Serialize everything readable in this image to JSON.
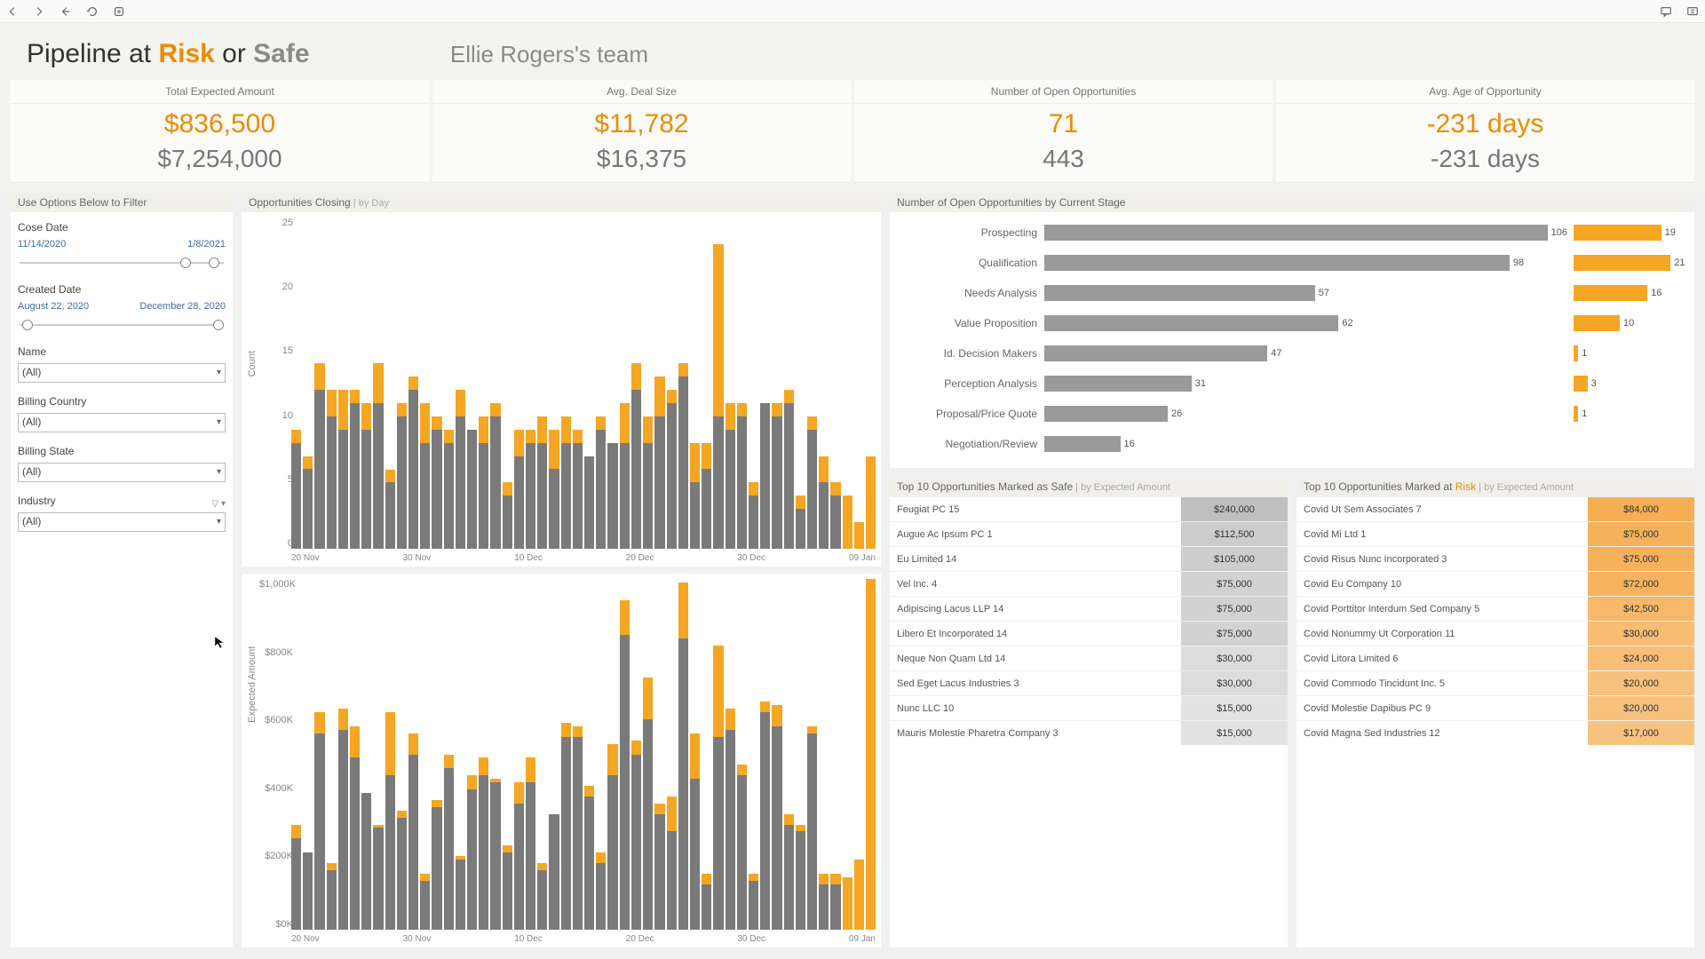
{
  "toolbar_icons": [
    "back",
    "forward",
    "undo-stop",
    "refresh-data",
    "pause-data",
    "comment",
    "present"
  ],
  "title": {
    "prefix": "Pipeline at ",
    "risk": "Risk",
    "middle": " or ",
    "safe": "Safe",
    "team": "Ellie Rogers's team"
  },
  "kpis": [
    {
      "label": "Total Expected Amount",
      "v1": "$836,500",
      "v2": "$7,254,000"
    },
    {
      "label": "Avg. Deal Size",
      "v1": "$11,782",
      "v2": "$16,375"
    },
    {
      "label": "Number of Open Opportunities",
      "v1": "71",
      "v2": "443"
    },
    {
      "label": "Avg. Age of Opportunity",
      "v1": "-231 days",
      "v2": "-231 days"
    }
  ],
  "filters": {
    "title": "Use Options Below to Filter",
    "close_date": {
      "label": "Cose Date",
      "from": "11/14/2020",
      "to": "1/8/2021",
      "knob1": 0.78,
      "knob2": 0.92
    },
    "created_date": {
      "label": "Created Date",
      "from": "August 22, 2020",
      "to": "December 28, 2020",
      "knob1": 0.02,
      "knob2": 0.94
    },
    "name": {
      "label": "Name",
      "value": "(All)"
    },
    "country": {
      "label": "Billing Country",
      "value": "(All)"
    },
    "state": {
      "label": "Billing State",
      "value": "(All)"
    },
    "industry": {
      "label": "Industry",
      "value": "(All)"
    }
  },
  "charts_panel_title": "Opportunities Closing",
  "charts_panel_sub": " | by Day",
  "stage_panel_title": "Number of Open Opportunities by Current Stage",
  "safe_table_title": "Top 10 Opportunities Marked as Safe",
  "risk_table_title": "Top 10 Opportunities Marked at ",
  "risk_table_risk_word": "Risk",
  "table_subtitle": " | by Expected Amount",
  "chart_data": [
    {
      "type": "bar",
      "title": "Opportunities Closing | by Day (Count)",
      "ylabel": "Count",
      "ylim": [
        0,
        25
      ],
      "yticks": [
        25,
        20,
        15,
        10,
        5,
        0
      ],
      "x_ticks": [
        "20 Nov",
        "30 Nov",
        "10 Dec",
        "20 Dec",
        "30 Dec",
        "09 Jan"
      ],
      "series": [
        {
          "name": "Safe",
          "color": "#7a7a7a"
        },
        {
          "name": "Risk",
          "color": "#f5a623"
        }
      ],
      "stacked": true,
      "data": [
        {
          "safe": 8,
          "risk": 1
        },
        {
          "safe": 6,
          "risk": 1
        },
        {
          "safe": 12,
          "risk": 2
        },
        {
          "safe": 10,
          "risk": 2
        },
        {
          "safe": 9,
          "risk": 3
        },
        {
          "safe": 11,
          "risk": 1
        },
        {
          "safe": 9,
          "risk": 2
        },
        {
          "safe": 11,
          "risk": 3
        },
        {
          "safe": 5,
          "risk": 1
        },
        {
          "safe": 10,
          "risk": 1
        },
        {
          "safe": 12,
          "risk": 1
        },
        {
          "safe": 8,
          "risk": 3
        },
        {
          "safe": 9,
          "risk": 1
        },
        {
          "safe": 8,
          "risk": 1
        },
        {
          "safe": 10,
          "risk": 2
        },
        {
          "safe": 9,
          "risk": 0
        },
        {
          "safe": 8,
          "risk": 2
        },
        {
          "safe": 10,
          "risk": 1
        },
        {
          "safe": 4,
          "risk": 1
        },
        {
          "safe": 7,
          "risk": 2
        },
        {
          "safe": 8,
          "risk": 1
        },
        {
          "safe": 8,
          "risk": 2
        },
        {
          "safe": 6,
          "risk": 3
        },
        {
          "safe": 8,
          "risk": 2
        },
        {
          "safe": 8,
          "risk": 1
        },
        {
          "safe": 7,
          "risk": 0
        },
        {
          "safe": 9,
          "risk": 1
        },
        {
          "safe": 8,
          "risk": 0
        },
        {
          "safe": 8,
          "risk": 3
        },
        {
          "safe": 12,
          "risk": 2
        },
        {
          "safe": 8,
          "risk": 2
        },
        {
          "safe": 10,
          "risk": 3
        },
        {
          "safe": 11,
          "risk": 1
        },
        {
          "safe": 13,
          "risk": 1
        },
        {
          "safe": 5,
          "risk": 3
        },
        {
          "safe": 6,
          "risk": 2
        },
        {
          "safe": 10,
          "risk": 13
        },
        {
          "safe": 9,
          "risk": 2
        },
        {
          "safe": 10,
          "risk": 1
        },
        {
          "safe": 4,
          "risk": 1
        },
        {
          "safe": 11,
          "risk": 0
        },
        {
          "safe": 10,
          "risk": 1
        },
        {
          "safe": 11,
          "risk": 1
        },
        {
          "safe": 3,
          "risk": 1
        },
        {
          "safe": 9,
          "risk": 1
        },
        {
          "safe": 5,
          "risk": 2
        },
        {
          "safe": 4,
          "risk": 1
        },
        {
          "safe": 0,
          "risk": 4
        },
        {
          "safe": 0,
          "risk": 2
        },
        {
          "safe": 0,
          "risk": 7
        }
      ]
    },
    {
      "type": "bar",
      "title": "Opportunities Closing | by Day (Expected Amount)",
      "ylabel": "Expected Amount",
      "ylim": [
        0,
        1000
      ],
      "yticks": [
        "$1,000K",
        "$800K",
        "$600K",
        "$400K",
        "$200K",
        "$0K"
      ],
      "x_ticks": [
        "20 Nov",
        "30 Nov",
        "10 Dec",
        "20 Dec",
        "30 Dec",
        "09 Jan"
      ],
      "series": [
        {
          "name": "Safe",
          "color": "#7a7a7a"
        },
        {
          "name": "Risk",
          "color": "#f5a623"
        }
      ],
      "stacked": true,
      "data": [
        {
          "safe": 260,
          "risk": 40
        },
        {
          "safe": 220,
          "risk": 0
        },
        {
          "safe": 560,
          "risk": 60
        },
        {
          "safe": 170,
          "risk": 20
        },
        {
          "safe": 570,
          "risk": 60
        },
        {
          "safe": 490,
          "risk": 90
        },
        {
          "safe": 390,
          "risk": 0
        },
        {
          "safe": 290,
          "risk": 10
        },
        {
          "safe": 440,
          "risk": 180
        },
        {
          "safe": 320,
          "risk": 20
        },
        {
          "safe": 500,
          "risk": 60
        },
        {
          "safe": 140,
          "risk": 20
        },
        {
          "safe": 350,
          "risk": 20
        },
        {
          "safe": 460,
          "risk": 40
        },
        {
          "safe": 200,
          "risk": 10
        },
        {
          "safe": 400,
          "risk": 40
        },
        {
          "safe": 440,
          "risk": 50
        },
        {
          "safe": 420,
          "risk": 10
        },
        {
          "safe": 220,
          "risk": 20
        },
        {
          "safe": 360,
          "risk": 60
        },
        {
          "safe": 420,
          "risk": 70
        },
        {
          "safe": 170,
          "risk": 20
        },
        {
          "safe": 330,
          "risk": 0
        },
        {
          "safe": 550,
          "risk": 40
        },
        {
          "safe": 550,
          "risk": 30
        },
        {
          "safe": 380,
          "risk": 30
        },
        {
          "safe": 190,
          "risk": 30
        },
        {
          "safe": 440,
          "risk": 90
        },
        {
          "safe": 840,
          "risk": 100
        },
        {
          "safe": 500,
          "risk": 40
        },
        {
          "safe": 600,
          "risk": 120
        },
        {
          "safe": 330,
          "risk": 30
        },
        {
          "safe": 280,
          "risk": 100
        },
        {
          "safe": 830,
          "risk": 160
        },
        {
          "safe": 430,
          "risk": 130
        },
        {
          "safe": 130,
          "risk": 30
        },
        {
          "safe": 550,
          "risk": 260
        },
        {
          "safe": 570,
          "risk": 60
        },
        {
          "safe": 440,
          "risk": 30
        },
        {
          "safe": 140,
          "risk": 20
        },
        {
          "safe": 620,
          "risk": 30
        },
        {
          "safe": 580,
          "risk": 60
        },
        {
          "safe": 300,
          "risk": 30
        },
        {
          "safe": 280,
          "risk": 20
        },
        {
          "safe": 560,
          "risk": 20
        },
        {
          "safe": 130,
          "risk": 30
        },
        {
          "safe": 130,
          "risk": 30
        },
        {
          "safe": 0,
          "risk": 150
        },
        {
          "safe": 0,
          "risk": 200
        },
        {
          "safe": 0,
          "risk": 1000
        }
      ]
    },
    {
      "type": "bar",
      "title": "Number of Open Opportunities by Current Stage",
      "orientation": "horizontal",
      "categories": [
        "Prospecting",
        "Qualification",
        "Needs Analysis",
        "Value Proposition",
        "Id. Decision Makers",
        "Perception Analysis",
        "Proposal/Price Quote",
        "Negotiation/Review"
      ],
      "series": [
        {
          "name": "Safe",
          "color": "#9a9a9a",
          "values": [
            106,
            98,
            57,
            62,
            47,
            31,
            26,
            16
          ]
        },
        {
          "name": "Risk",
          "color": "#f5a623",
          "values": [
            19,
            21,
            16,
            10,
            1,
            3,
            1,
            0
          ]
        }
      ],
      "max_safe": 110,
      "max_risk": 25
    }
  ],
  "safe_table": [
    {
      "name": "Feugiat PC 15",
      "amount": "$240,000",
      "shade": 1.0
    },
    {
      "name": "Augue Ac Ipsum PC 1",
      "amount": "$112,500",
      "shade": 0.8
    },
    {
      "name": "Eu Limited 14",
      "amount": "$105,000",
      "shade": 0.78
    },
    {
      "name": "Vel Inc. 4",
      "amount": "$75,000",
      "shade": 0.7
    },
    {
      "name": "Adipiscing Lacus LLP 14",
      "amount": "$75,000",
      "shade": 0.7
    },
    {
      "name": "Libero Et Incorporated 14",
      "amount": "$75,000",
      "shade": 0.7
    },
    {
      "name": "Neque Non Quam Ltd 14",
      "amount": "$30,000",
      "shade": 0.55
    },
    {
      "name": "Sed Eget Lacus Industries 3",
      "amount": "$30,000",
      "shade": 0.55
    },
    {
      "name": "Nunc LLC 10",
      "amount": "$15,000",
      "shade": 0.45
    },
    {
      "name": "Mauris Molestie Pharetra Company 3",
      "amount": "$15,000",
      "shade": 0.45
    }
  ],
  "risk_table": [
    {
      "name": "Covid Ut Sem Associates 7",
      "amount": "$84,000",
      "shade": 1.0
    },
    {
      "name": "Covid Mi Ltd 1",
      "amount": "$75,000",
      "shade": 0.96
    },
    {
      "name": "Covid Risus Nunc Incorporated 3",
      "amount": "$75,000",
      "shade": 0.96
    },
    {
      "name": "Covid Eu Company 10",
      "amount": "$72,000",
      "shade": 0.94
    },
    {
      "name": "Covid Porttitor Interdum Sed Company 5",
      "amount": "$42,500",
      "shade": 0.86
    },
    {
      "name": "Covid Nonummy Ut Corporation 11",
      "amount": "$30,000",
      "shade": 0.8
    },
    {
      "name": "Covid Litora Limited 6",
      "amount": "$24,000",
      "shade": 0.76
    },
    {
      "name": "Covid Commodo Tincidunt Inc. 5",
      "amount": "$20,000",
      "shade": 0.72
    },
    {
      "name": "Covid Molestie Dapibus PC 9",
      "amount": "$20,000",
      "shade": 0.72
    },
    {
      "name": "Covid Magna Sed Industries 12",
      "amount": "$17,000",
      "shade": 0.7
    }
  ]
}
